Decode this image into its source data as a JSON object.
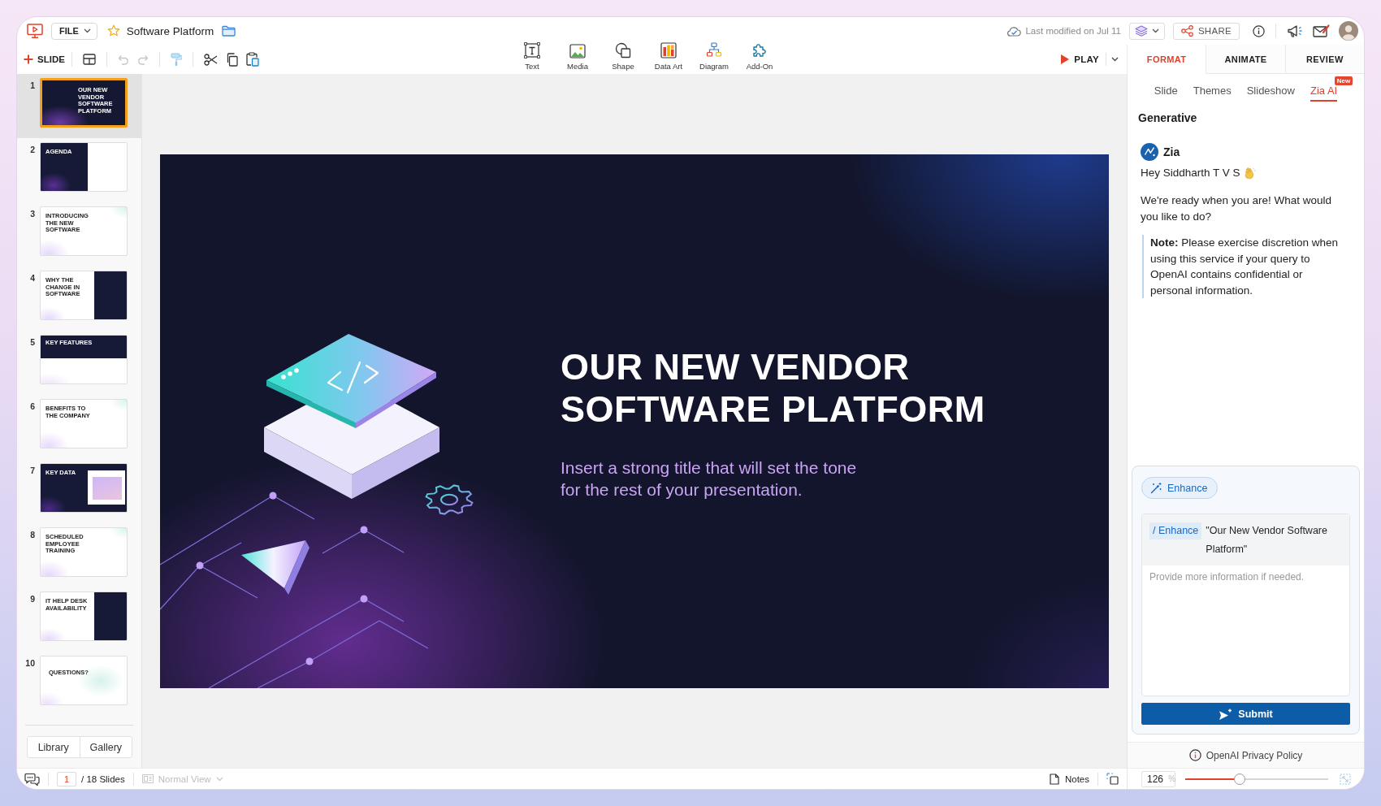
{
  "header": {
    "file_menu": "FILE",
    "document_title": "Software Platform",
    "last_modified": "Last modified on Jul 11",
    "share": "SHARE"
  },
  "edit_toolbar": {
    "new_slide": "SLIDE",
    "undo": {
      "disabled": true
    },
    "redo": {
      "disabled": true
    }
  },
  "insert_tools": [
    {
      "kind": "text",
      "label": "Text"
    },
    {
      "kind": "media",
      "label": "Media"
    },
    {
      "kind": "shape",
      "label": "Shape"
    },
    {
      "kind": "data_art",
      "label": "Data Art"
    },
    {
      "kind": "diagram",
      "label": "Diagram"
    },
    {
      "kind": "add_on",
      "label": "Add-On"
    }
  ],
  "play": "PLAY",
  "slides": [
    {
      "number": "1",
      "title": "OUR NEW VENDOR SOFTWARE PLATFORM",
      "kind": "cover",
      "selected": true
    },
    {
      "number": "2",
      "title": "AGENDA",
      "kind": "split_dark_left",
      "selected": false
    },
    {
      "number": "3",
      "title": "INTRODUCING THE NEW SOFTWARE",
      "kind": "light",
      "selected": false
    },
    {
      "number": "4",
      "title": "WHY THE CHANGE IN SOFTWARE",
      "kind": "split_dark_right",
      "selected": false
    },
    {
      "number": "5",
      "title": "KEY FEATURES",
      "kind": "dark_band",
      "selected": false
    },
    {
      "number": "6",
      "title": "BENEFITS TO THE COMPANY",
      "kind": "light",
      "selected": false
    },
    {
      "number": "7",
      "title": "KEY DATA",
      "kind": "chart",
      "selected": false
    },
    {
      "number": "8",
      "title": "SCHEDULED EMPLOYEE TRAINING",
      "kind": "light",
      "selected": false
    },
    {
      "number": "9",
      "title": "IT HELP DESK AVAILABILITY",
      "kind": "split_dark_right",
      "selected": false
    },
    {
      "number": "10",
      "title": "QUESTIONS?",
      "kind": "closing",
      "selected": false
    }
  ],
  "library_tabs": [
    "Library",
    "Gallery"
  ],
  "slide": {
    "title": "OUR NEW VENDOR SOFTWARE PLATFORM",
    "subtitle": "Insert a strong title that will set the tone for the rest of your presentation."
  },
  "side_panel": {
    "tabs": [
      {
        "label": "FORMAT",
        "selected": true
      },
      {
        "label": "ANIMATE",
        "selected": false
      },
      {
        "label": "REVIEW",
        "selected": false
      }
    ],
    "sub_tabs": [
      {
        "label": "Slide",
        "selected": false
      },
      {
        "label": "Themes",
        "selected": false
      },
      {
        "label": "Slideshow",
        "selected": false
      },
      {
        "label": "Zia AI",
        "selected": true,
        "badge": "New"
      }
    ],
    "section": "Generative",
    "assistant": "Zia",
    "greeting": "Hey Siddharth T V S",
    "intro": "We're ready when you are! What would you like to do?",
    "note": "**Note:** Please exercise discretion when using this service if your query to OpenAI contains confidential or personal information.",
    "action": "Enhance",
    "command": "/ Enhance",
    "prompt": "\"Our New Vendor Software Platform\"",
    "placeholder": "Provide more information if needed.",
    "submit": "Submit",
    "privacy_link": "OpenAI Privacy Policy"
  },
  "status_bar": {
    "page": "1",
    "slide_count": "/ 18 Slides",
    "view": {
      "label": "Normal View",
      "disabled": true
    },
    "notes": "Notes",
    "zoom": "126",
    "zoom_unit": "%",
    "zoom_slider": {
      "level": 0.38
    }
  }
}
